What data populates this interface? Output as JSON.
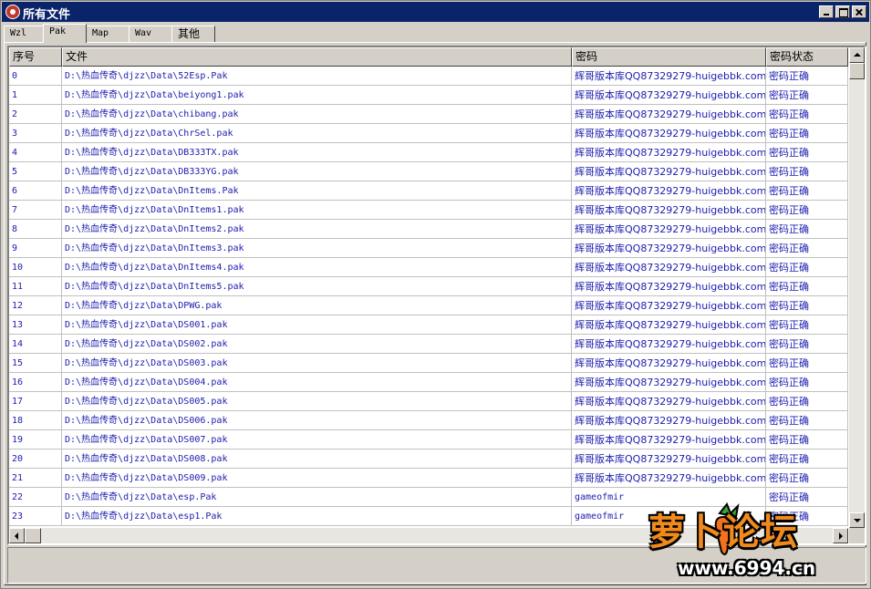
{
  "window": {
    "title": "所有文件"
  },
  "tabs": [
    {
      "label": "Wzl",
      "active": false
    },
    {
      "label": "Pak",
      "active": true
    },
    {
      "label": "Map",
      "active": false
    },
    {
      "label": "Wav",
      "active": false
    },
    {
      "label": "其他",
      "active": false
    }
  ],
  "table": {
    "columns": [
      "序号",
      "文件",
      "密码",
      "密码状态"
    ],
    "rows": [
      [
        "0",
        "D:\\热血传奇\\djzz\\Data\\52Esp.Pak",
        "辉哥版本库QQ87329279-huigebbk.com",
        "密码正确"
      ],
      [
        "1",
        "D:\\热血传奇\\djzz\\Data\\beiyong1.pak",
        "辉哥版本库QQ87329279-huigebbk.com",
        "密码正确"
      ],
      [
        "2",
        "D:\\热血传奇\\djzz\\Data\\chibang.pak",
        "辉哥版本库QQ87329279-huigebbk.com",
        "密码正确"
      ],
      [
        "3",
        "D:\\热血传奇\\djzz\\Data\\ChrSel.pak",
        "辉哥版本库QQ87329279-huigebbk.com",
        "密码正确"
      ],
      [
        "4",
        "D:\\热血传奇\\djzz\\Data\\DB333TX.pak",
        "辉哥版本库QQ87329279-huigebbk.com",
        "密码正确"
      ],
      [
        "5",
        "D:\\热血传奇\\djzz\\Data\\DB333YG.pak",
        "辉哥版本库QQ87329279-huigebbk.com",
        "密码正确"
      ],
      [
        "6",
        "D:\\热血传奇\\djzz\\Data\\DnItems.Pak",
        "辉哥版本库QQ87329279-huigebbk.com",
        "密码正确"
      ],
      [
        "7",
        "D:\\热血传奇\\djzz\\Data\\DnItems1.pak",
        "辉哥版本库QQ87329279-huigebbk.com",
        "密码正确"
      ],
      [
        "8",
        "D:\\热血传奇\\djzz\\Data\\DnItems2.pak",
        "辉哥版本库QQ87329279-huigebbk.com",
        "密码正确"
      ],
      [
        "9",
        "D:\\热血传奇\\djzz\\Data\\DnItems3.pak",
        "辉哥版本库QQ87329279-huigebbk.com",
        "密码正确"
      ],
      [
        "10",
        "D:\\热血传奇\\djzz\\Data\\DnItems4.pak",
        "辉哥版本库QQ87329279-huigebbk.com",
        "密码正确"
      ],
      [
        "11",
        "D:\\热血传奇\\djzz\\Data\\DnItems5.pak",
        "辉哥版本库QQ87329279-huigebbk.com",
        "密码正确"
      ],
      [
        "12",
        "D:\\热血传奇\\djzz\\Data\\DPWG.pak",
        "辉哥版本库QQ87329279-huigebbk.com",
        "密码正确"
      ],
      [
        "13",
        "D:\\热血传奇\\djzz\\Data\\DS001.pak",
        "辉哥版本库QQ87329279-huigebbk.com",
        "密码正确"
      ],
      [
        "14",
        "D:\\热血传奇\\djzz\\Data\\DS002.pak",
        "辉哥版本库QQ87329279-huigebbk.com",
        "密码正确"
      ],
      [
        "15",
        "D:\\热血传奇\\djzz\\Data\\DS003.pak",
        "辉哥版本库QQ87329279-huigebbk.com",
        "密码正确"
      ],
      [
        "16",
        "D:\\热血传奇\\djzz\\Data\\DS004.pak",
        "辉哥版本库QQ87329279-huigebbk.com",
        "密码正确"
      ],
      [
        "17",
        "D:\\热血传奇\\djzz\\Data\\DS005.pak",
        "辉哥版本库QQ87329279-huigebbk.com",
        "密码正确"
      ],
      [
        "18",
        "D:\\热血传奇\\djzz\\Data\\DS006.pak",
        "辉哥版本库QQ87329279-huigebbk.com",
        "密码正确"
      ],
      [
        "19",
        "D:\\热血传奇\\djzz\\Data\\DS007.pak",
        "辉哥版本库QQ87329279-huigebbk.com",
        "密码正确"
      ],
      [
        "20",
        "D:\\热血传奇\\djzz\\Data\\DS008.pak",
        "辉哥版本库QQ87329279-huigebbk.com",
        "密码正确"
      ],
      [
        "21",
        "D:\\热血传奇\\djzz\\Data\\DS009.pak",
        "辉哥版本库QQ87329279-huigebbk.com",
        "密码正确"
      ],
      [
        "22",
        "D:\\热血传奇\\djzz\\Data\\esp.Pak",
        "gameofmir",
        "密码正确"
      ],
      [
        "23",
        "D:\\热血传奇\\djzz\\Data\\esp1.Pak",
        "gameofmir",
        "密码正确"
      ]
    ]
  },
  "watermark": {
    "logo_text": "萝卜论坛",
    "url": "www.6994.cn"
  },
  "colors": {
    "titlebar": "#0a246a",
    "row_text": "#1c1cae",
    "watermark": "#f08a1c"
  }
}
